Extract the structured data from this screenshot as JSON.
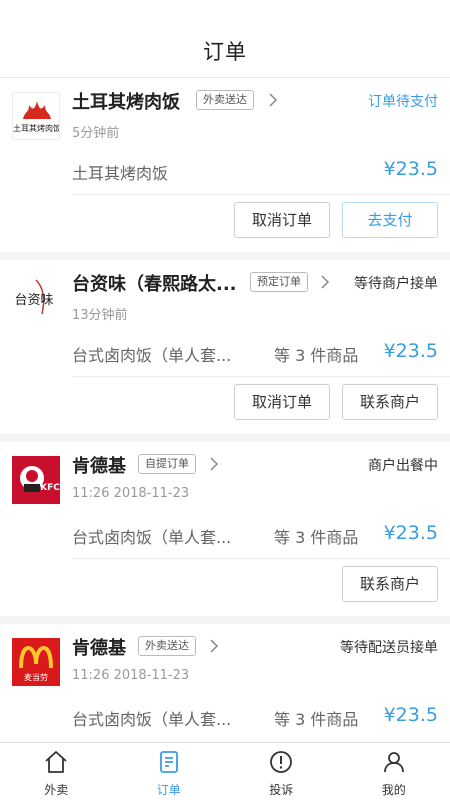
{
  "header": {
    "title": "订单"
  },
  "orders": [
    {
      "shop": "土耳其烤肉饭",
      "tag": "外卖送达",
      "status": "订单待支付",
      "time": "5分钟前",
      "goods": "土耳其烤肉饭",
      "count": "",
      "price": "¥23.5",
      "logo_text": "土耳其烤肉饭",
      "buttons": [
        "取消订单",
        "去支付"
      ]
    },
    {
      "shop": "台资味（春熙路太...",
      "tag": "预定订单",
      "status": "等待商户接单",
      "time": "13分钟前",
      "goods": "台式卤肉饭（单人套...",
      "count": "等 3 件商品",
      "price": "¥23.5",
      "logo_text": "台资味",
      "buttons": [
        "取消订单",
        "联系商户"
      ]
    },
    {
      "shop": "肯德基",
      "tag": "自提订单",
      "status": "商户出餐中",
      "time": "11:26   2018-11-23",
      "goods": "台式卤肉饭（单人套...",
      "count": "等 3 件商品",
      "price": "¥23.5",
      "logo_text": "KFC",
      "buttons": [
        "联系商户"
      ]
    },
    {
      "shop": "肯德基",
      "tag": "外卖送达",
      "status": "等待配送员接单",
      "time": "11:26   2018-11-23",
      "goods": "台式卤肉饭（单人套...",
      "count": "等 3 件商品",
      "price": "¥23.5",
      "logo_text": "麦当劳",
      "buttons": []
    }
  ],
  "tabbar": [
    {
      "label": "外卖",
      "icon": "home-icon"
    },
    {
      "label": "订单",
      "icon": "order-icon"
    },
    {
      "label": "投诉",
      "icon": "complaint-icon"
    },
    {
      "label": "我的",
      "icon": "profile-icon"
    }
  ],
  "colors": {
    "accent": "#3a9de0",
    "text": "#333333",
    "muted": "#999999",
    "background": "#f4f4f4"
  }
}
